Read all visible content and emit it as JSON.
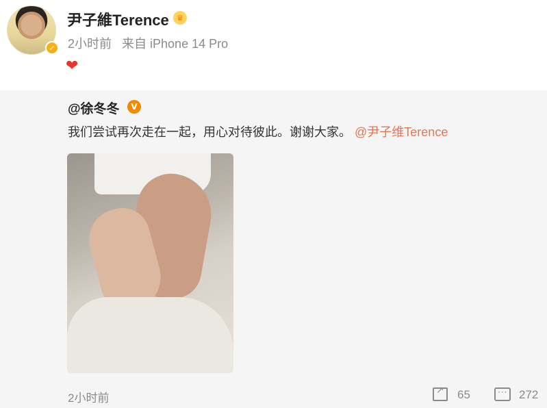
{
  "post": {
    "author": "尹子維Terence",
    "time": "2小时前",
    "source": "来自 iPhone 14 Pro",
    "content_icon": "heart-icon"
  },
  "repost": {
    "author": "@徐冬冬",
    "text": "我们尝试再次走在一起，用心对待彼此。谢谢大家。",
    "mention": "@尹子维Terence",
    "image_subject": "holding-hands-photo"
  },
  "footer": {
    "time": "2小时前",
    "share_count": "65",
    "comment_count": "272"
  },
  "colors": {
    "mention": "#eb7350",
    "heart": "#e8362b",
    "verified_badge": "#f6b016",
    "repost_background": "#f5f5f5"
  }
}
